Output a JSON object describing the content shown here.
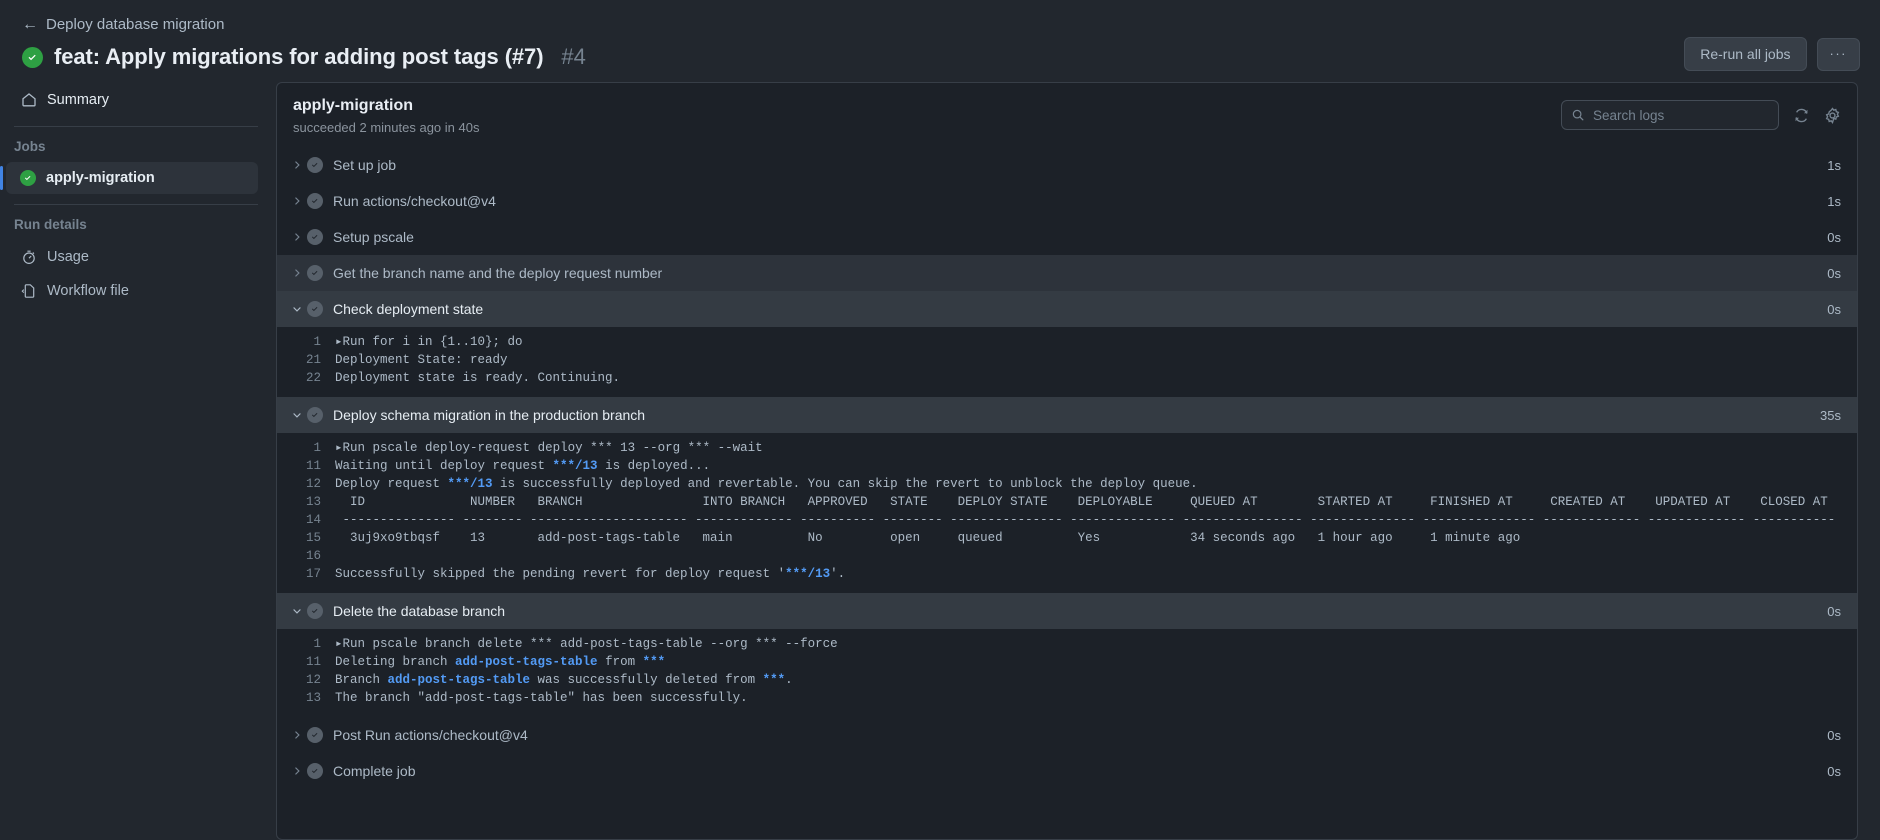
{
  "header": {
    "back_icon": "arrow-left-icon",
    "breadcrumb": "Deploy database migration",
    "status_icon": "success-check-icon",
    "title": "feat: Apply migrations for adding post tags (#7)",
    "run_number": "#4",
    "rerun_label": "Re-run all jobs",
    "kebab_label": "···"
  },
  "sidebar": {
    "summary": {
      "label": "Summary",
      "icon": "home-icon"
    },
    "jobs_heading": "Jobs",
    "jobs": [
      {
        "label": "apply-migration",
        "icon": "success-check-icon",
        "selected": true
      }
    ],
    "run_details_heading": "Run details",
    "run_details": [
      {
        "label": "Usage",
        "icon": "stopwatch-icon"
      },
      {
        "label": "Workflow file",
        "icon": "file-code-icon"
      }
    ]
  },
  "logs": {
    "title": "apply-migration",
    "subtitle": "succeeded 2 minutes ago in 40s",
    "search_placeholder": "Search logs",
    "search_value": "",
    "search_icon": "search-icon",
    "refresh_icon": "refresh-icon",
    "settings_icon": "gear-icon",
    "steps": [
      {
        "label": "Set up job",
        "duration": "1s",
        "expanded": false,
        "hovered": false,
        "lines": []
      },
      {
        "label": "Run actions/checkout@v4",
        "duration": "1s",
        "expanded": false,
        "hovered": false,
        "lines": []
      },
      {
        "label": "Setup pscale",
        "duration": "0s",
        "expanded": false,
        "hovered": false,
        "lines": []
      },
      {
        "label": "Get the branch name and the deploy request number",
        "duration": "0s",
        "expanded": false,
        "hovered": true,
        "lines": []
      },
      {
        "label": "Check deployment state",
        "duration": "0s",
        "expanded": true,
        "hovered": false,
        "lines": [
          {
            "num": "1",
            "html": "<span class='tri'>▸</span>Run for i in {1..10}; do"
          },
          {
            "num": "21",
            "html": "Deployment State: ready"
          },
          {
            "num": "22",
            "html": "Deployment state is ready. Continuing."
          }
        ]
      },
      {
        "label": "Deploy schema migration in the production branch",
        "duration": "35s",
        "expanded": true,
        "hovered": false,
        "lines": [
          {
            "num": "1",
            "html": "<span class='tri'>▸</span>Run pscale deploy-request deploy *** 13 --org *** --wait"
          },
          {
            "num": "11",
            "html": "Waiting until deploy request <span class='tok-blue'>***/13</span> is deployed..."
          },
          {
            "num": "12",
            "html": "Deploy request <span class='tok-blue'>***/13</span> is successfully deployed and revertable. You can skip the revert to unblock the deploy queue."
          },
          {
            "num": "13",
            "html": "  ID              NUMBER   BRANCH                INTO BRANCH   APPROVED   STATE    DEPLOY STATE    DEPLOYABLE     QUEUED AT        STARTED AT     FINISHED AT     CREATED AT    UPDATED AT    CLOSED AT"
          },
          {
            "num": "14",
            "html": " --------------- -------- --------------------- ------------- ---------- -------- --------------- -------------- ---------------- -------------- --------------- ------------- ------------- -----------"
          },
          {
            "num": "15",
            "html": "  3uj9xo9tbqsf    13       add-post-tags-table   main          No         open     queued          Yes            34 seconds ago   1 hour ago     1 minute ago"
          },
          {
            "num": "16",
            "html": ""
          },
          {
            "num": "17",
            "html": "Successfully skipped the pending revert for deploy request '<span class='tok-blue'>***/13</span>'."
          }
        ]
      },
      {
        "label": "Delete the database branch",
        "duration": "0s",
        "expanded": true,
        "hovered": false,
        "lines": [
          {
            "num": "1",
            "html": "<span class='tri'>▸</span>Run pscale branch delete *** add-post-tags-table --org *** --force"
          },
          {
            "num": "11",
            "html": "Deleting branch <span class='tok-blue'>add-post-tags-table</span> from <span class='tok-blue'>***</span>"
          },
          {
            "num": "12",
            "html": "Branch <span class='tok-blue'>add-post-tags-table</span> was successfully deleted from <span class='tok-blue'>***</span>."
          },
          {
            "num": "13",
            "html": "The branch \"add-post-tags-table\" has been successfully."
          }
        ]
      },
      {
        "label": "Post Run actions/checkout@v4",
        "duration": "0s",
        "expanded": false,
        "hovered": false,
        "lines": []
      },
      {
        "label": "Complete job",
        "duration": "0s",
        "expanded": false,
        "hovered": false,
        "lines": []
      }
    ]
  },
  "colors": {
    "success_green": "#2ea043",
    "accent_blue": "#4184e4",
    "token_blue": "#539bf5",
    "panel_bg": "#1c2128",
    "page_bg": "#22272e"
  }
}
